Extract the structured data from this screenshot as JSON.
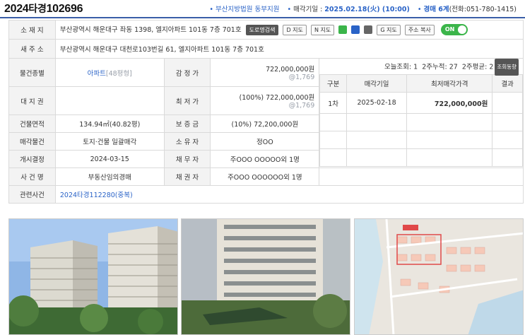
{
  "header": {
    "case_prefix": "2024",
    "case_type": "타경",
    "case_number": "102696",
    "court": "부산지방법원 동부지원",
    "sale_date_label": "매각기일 : ",
    "sale_date": "2025.02.18(火) (10:00)",
    "dept_label": "경매 6계",
    "phone": "(전화:051-780-1415)"
  },
  "info": {
    "address_label": "소 재 지",
    "address": "부산광역시 해운대구 좌동 1398, 엘지아파트 101동 7층 701호",
    "road_search_btn": "도로명검색",
    "map_btn_1": "D 지도",
    "map_btn_2": "N 지도",
    "map_btn_3": "G 지도",
    "copy_btn": "주소 복사",
    "toggle_label": "ON",
    "new_address_label": "새 주 소",
    "new_address": "부산광역시 해운대구 대천로103번길 61, 엘지아파트 101동 7층 701호",
    "type_label": "물건종별",
    "type_value": "아파트",
    "type_size": "[48평형]",
    "appraisal_label": "감 정 가",
    "appraisal_value": "722,000,000원",
    "appraisal_unit": "@1,769",
    "land_label": "대 지 권",
    "land_value": "",
    "min_price_label": "최 저 가",
    "min_price_value": "(100%) 722,000,000원",
    "min_price_unit": "@1,769",
    "building_label": "건물면적",
    "building_value": "134.94㎡(40.82평)",
    "deposit_label": "보 증 금",
    "deposit_value": "(10%) 72,200,000원",
    "sale_item_label": "매각물건",
    "sale_item_value": "토지·건물 일괄매각",
    "owner_label": "소 유 자",
    "owner_value": "정OO",
    "start_label": "개시결정",
    "start_value": "2024-03-15",
    "debtor_label": "채 무 자",
    "debtor_value": "주OOO OOOOO외 1명",
    "case_name_label": "사 건 명",
    "case_name_value": "부동산임의경매",
    "creditor_label": "채 권 자",
    "creditor_value": "주OOO OOOOOO외 1명",
    "related_label": "관련사건",
    "related_value": "2024타경112280(중복)"
  },
  "history": {
    "views_today": "오늘조회: 1",
    "views_2weeks": "2주누적: 27",
    "views_avg": "2주평균: 2",
    "views_btn": "조회동향",
    "col_round": "구분",
    "col_date": "매각기일",
    "col_price": "최저매각가격",
    "col_result": "결과",
    "rows": [
      {
        "round": "1차",
        "date": "2025-02-18",
        "price": "722,000,000원",
        "result": ""
      }
    ]
  }
}
